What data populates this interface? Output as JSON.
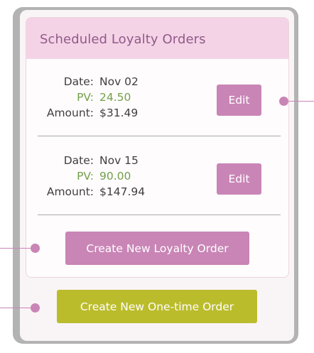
{
  "panel": {
    "title": "Scheduled Loyalty Orders"
  },
  "labels": {
    "date": "Date:",
    "pv": "PV:",
    "amount": "Amount:"
  },
  "orders": [
    {
      "date": "Nov 02",
      "pv": "24.50",
      "amount": "$31.49",
      "edit_label": "Edit"
    },
    {
      "date": "Nov 15",
      "pv": "90.00",
      "amount": "$147.94",
      "edit_label": "Edit"
    }
  ],
  "actions": {
    "create_loyalty_label": "Create New Loyalty Order",
    "create_onetime_label": "Create New One-time Order"
  },
  "colors": {
    "accent_pink": "#c985b6",
    "header_pink": "#f5d3e7",
    "title_text": "#8f5a88",
    "pv_green": "#72a04b",
    "onetime_olive": "#bbbc2c",
    "frame_gray": "#b3b3b3"
  }
}
